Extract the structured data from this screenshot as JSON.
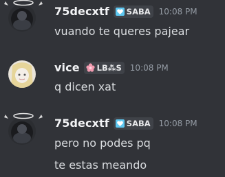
{
  "messages": [
    {
      "author": "75decxtf",
      "tag": "SABA",
      "tag_icon": "heart-icon",
      "tag_icon_color": "#5ec7f0",
      "time": "10:08 PM",
      "lines": [
        "vuando te queres pajear"
      ]
    },
    {
      "author": "vice",
      "tag": "LB⁂S",
      "tag_icon": "flower-icon",
      "tag_icon_color": "#f29bb0",
      "time": "10:08 PM",
      "lines": [
        "q dicen xat"
      ]
    },
    {
      "author": "75decxtf",
      "tag": "SABA",
      "tag_icon": "heart-icon",
      "tag_icon_color": "#5ec7f0",
      "time": "10:08 PM",
      "lines": [
        "pero no podes pq",
        "te estas meando"
      ]
    }
  ],
  "colors": {
    "background": "#313338",
    "username": "#f2f3f5",
    "message_text": "#dbdee1",
    "timestamp": "#949ba4",
    "tag_background": "#3f4248"
  }
}
